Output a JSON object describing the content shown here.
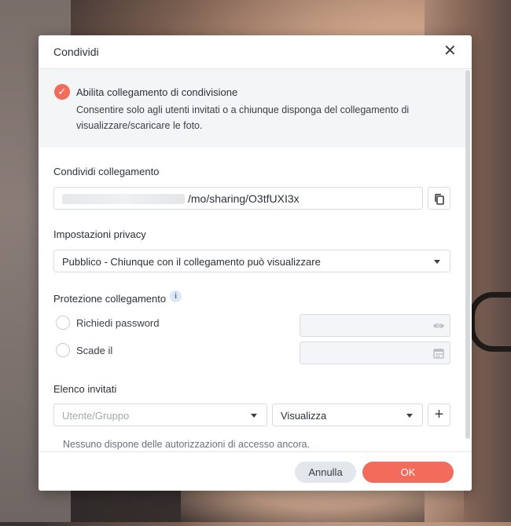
{
  "dialog": {
    "title": "Condividi",
    "close_icon": "close-icon",
    "ok_label": "OK",
    "cancel_label": "Annulla",
    "accent_color": "#f26b5b"
  },
  "enable_sharing": {
    "checked": true,
    "title": "Abilita collegamento di condivisione",
    "description": "Consentire solo agli utenti invitati o a chiunque disponga del collegamento di visualizzare/scaricare le foto."
  },
  "share_link": {
    "label": "Condividi collegamento",
    "url_visible": "/mo/sharing/O3tfUXI3x",
    "copy_icon": "copy-icon"
  },
  "privacy": {
    "label": "Impostazioni privacy",
    "selected": "Pubblico - Chiunque con il collegamento può visualizzare"
  },
  "link_protection": {
    "label": "Protezione collegamento",
    "info_icon": "info-icon",
    "password_label": "Richiedi password",
    "password_checked": false,
    "expire_label": "Scade il",
    "expire_checked": false
  },
  "invitees": {
    "label": "Elenco invitati",
    "user_placeholder": "Utente/Gruppo",
    "permission_selected": "Visualizza",
    "add_icon": "plus-icon",
    "empty_message": "Nessuno dispone delle autorizzazioni di accesso ancora."
  }
}
